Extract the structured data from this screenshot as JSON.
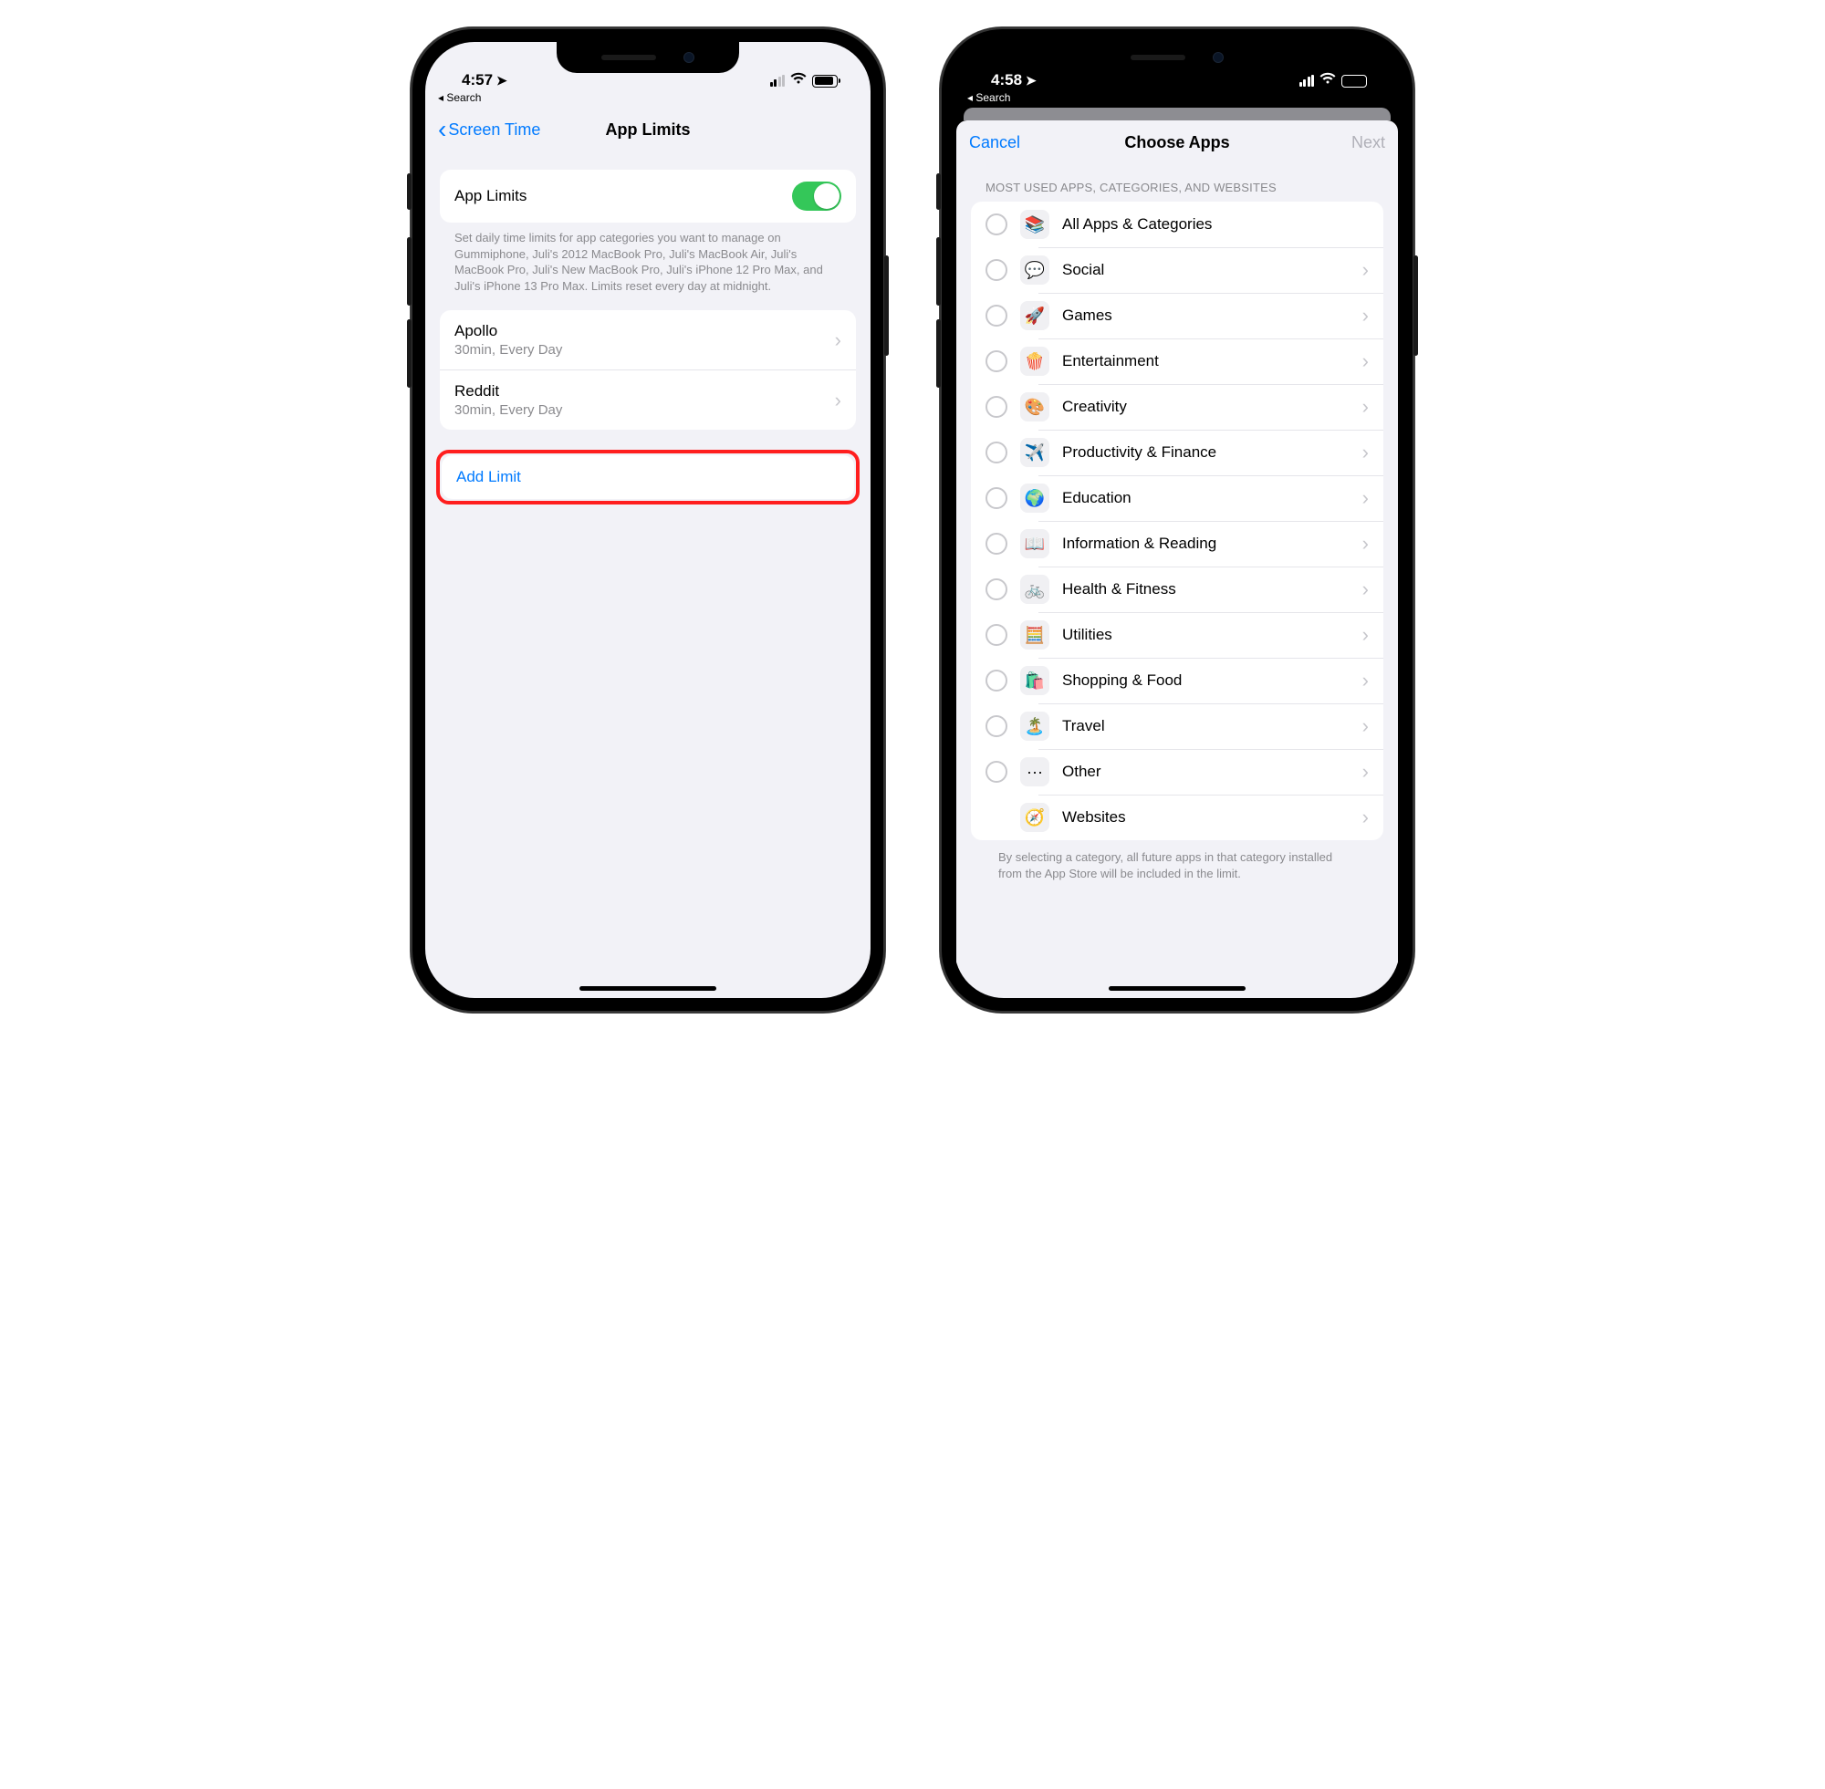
{
  "left": {
    "time": "4:57",
    "breadcrumb": "◂ Search",
    "nav_back": "Screen Time",
    "nav_title": "App Limits",
    "toggle_label": "App Limits",
    "description": "Set daily time limits for app categories you want to manage on Gummiphone, Juli's 2012 MacBook Pro, Juli's MacBook Air, Juli's MacBook Pro, Juli's New MacBook Pro, Juli's iPhone 12 Pro Max, and Juli's iPhone 13 Pro Max. Limits reset every day at midnight.",
    "limits": [
      {
        "name": "Apollo",
        "detail": "30min, Every Day"
      },
      {
        "name": "Reddit",
        "detail": "30min, Every Day"
      }
    ],
    "add_limit": "Add Limit"
  },
  "right": {
    "time": "4:58",
    "breadcrumb": "◂ Search",
    "cancel": "Cancel",
    "title": "Choose Apps",
    "next": "Next",
    "section_header": "MOST USED APPS, CATEGORIES, AND WEBSITES",
    "categories": [
      {
        "emoji": "📚",
        "label": "All Apps & Categories",
        "chevron": false
      },
      {
        "emoji": "💬",
        "label": "Social",
        "chevron": true
      },
      {
        "emoji": "🚀",
        "label": "Games",
        "chevron": true
      },
      {
        "emoji": "🍿",
        "label": "Entertainment",
        "chevron": true
      },
      {
        "emoji": "🎨",
        "label": "Creativity",
        "chevron": true
      },
      {
        "emoji": "✈️",
        "label": "Productivity & Finance",
        "chevron": true
      },
      {
        "emoji": "🌍",
        "label": "Education",
        "chevron": true
      },
      {
        "emoji": "📖",
        "label": "Information & Reading",
        "chevron": true
      },
      {
        "emoji": "🚲",
        "label": "Health & Fitness",
        "chevron": true
      },
      {
        "emoji": "🧮",
        "label": "Utilities",
        "chevron": true
      },
      {
        "emoji": "🛍️",
        "label": "Shopping & Food",
        "chevron": true
      },
      {
        "emoji": "🏝️",
        "label": "Travel",
        "chevron": true
      },
      {
        "emoji": "···",
        "label": "Other",
        "chevron": true
      }
    ],
    "websites": {
      "emoji": "🧭",
      "label": "Websites"
    },
    "footer": "By selecting a category, all future apps in that category installed from the App Store will be included in the limit."
  }
}
